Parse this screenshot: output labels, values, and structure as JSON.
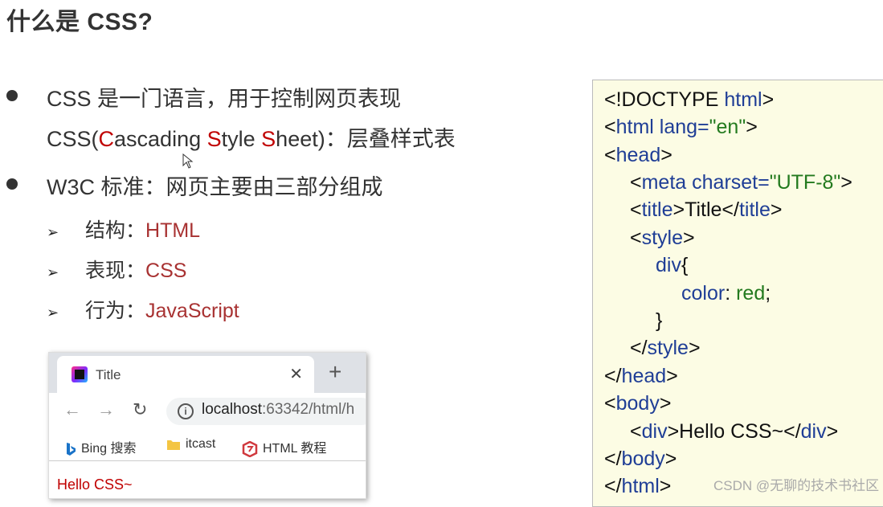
{
  "title": "什么是 CSS?",
  "bullets": {
    "b1_line1": "CSS 是一门语言，用于控制网页表现",
    "b1_line2": {
      "p1": "CSS(",
      "c": "C",
      "p2": "ascading ",
      "s": "S",
      "p3": "tyle ",
      "s2": "S",
      "p4": "heet)：层叠样式表"
    },
    "b2": "W3C 标准：网页主要由三部分组成",
    "subs": [
      {
        "label": "结构：",
        "value": "HTML"
      },
      {
        "label": "表现：",
        "value": "CSS"
      },
      {
        "label": "行为：",
        "value": "JavaScript"
      }
    ]
  },
  "browser": {
    "tab_title": "Title",
    "tab_close": "✕",
    "new_tab": "+",
    "back": "←",
    "forward": "→",
    "reload": "↻",
    "url_host": "localhost",
    "url_rest": ":63342/html/h",
    "bookmarks": [
      "Bing 搜索",
      "itcast",
      "HTML 教程"
    ],
    "page_text": "Hello CSS~"
  },
  "code": {
    "l1a": "<!DOCTYPE ",
    "l1b": "html",
    "l1c": ">",
    "l2a": "<",
    "l2b": "html lang=",
    "l2c": "\"en\"",
    "l2d": ">",
    "l3a": "<",
    "l3b": "head",
    "l3c": ">",
    "l4a": "<",
    "l4b": "meta charset=",
    "l4c": "\"UTF-8\"",
    "l4d": ">",
    "l5a": "<",
    "l5b": "title",
    "l5c": ">Title</",
    "l5d": "title",
    "l5e": ">",
    "l6a": "<",
    "l6b": "style",
    "l6c": ">",
    "l7a": "div",
    "l7b": "{",
    "l8a": "color",
    "l8b": ": ",
    "l8c": "red",
    "l8d": ";",
    "l9": "}",
    "l10a": "</",
    "l10b": "style",
    "l10c": ">",
    "l11a": "</",
    "l11b": "head",
    "l11c": ">",
    "l12a": "<",
    "l12b": "body",
    "l12c": ">",
    "l13a": "<",
    "l13b": "div",
    "l13c": ">Hello CSS~</",
    "l13d": "div",
    "l13e": ">",
    "l14a": "</",
    "l14b": "body",
    "l14c": ">",
    "l15a": "</",
    "l15b": "html",
    "l15c": ">"
  },
  "watermark": "CSDN @无聊的技术书社区"
}
